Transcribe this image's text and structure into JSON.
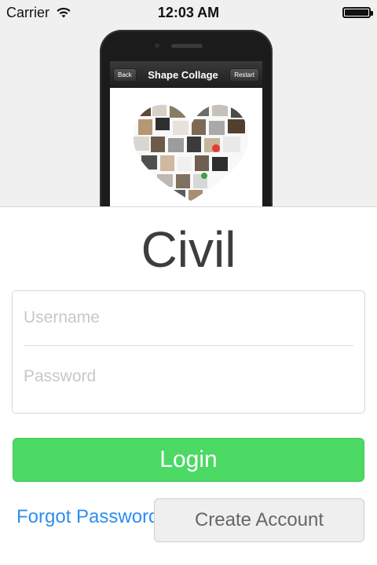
{
  "status_bar": {
    "carrier": "Carrier",
    "time": "12:03 AM"
  },
  "preview": {
    "nav_title": "Shape Collage",
    "back_label": "Back",
    "restart_label": "Restart"
  },
  "app": {
    "title": "Civil"
  },
  "form": {
    "username_placeholder": "Username",
    "password_placeholder": "Password"
  },
  "actions": {
    "login_label": "Login",
    "forgot_label": "Forgot Password",
    "create_label": "Create Account"
  }
}
